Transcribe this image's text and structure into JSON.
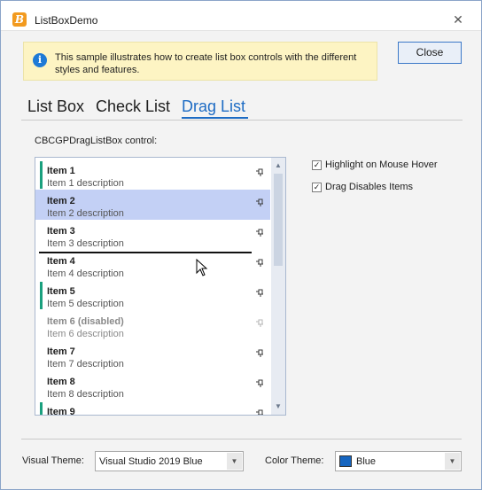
{
  "window": {
    "title": "ListBoxDemo",
    "app_icon_letter": "B"
  },
  "info": {
    "text": "This sample illustrates how to create list box controls with the different styles and features."
  },
  "buttons": {
    "close_label": "Close"
  },
  "tabs": [
    {
      "label": "List Box",
      "active": false
    },
    {
      "label": "Check List",
      "active": false
    },
    {
      "label": "Drag List",
      "active": true
    }
  ],
  "control_label": "CBCGPDragListBox control:",
  "list_items": [
    {
      "title": "Item 1",
      "desc": "Item 1 description",
      "accent": true,
      "selected": false,
      "disabled": false
    },
    {
      "title": "Item 2",
      "desc": "Item 2 description",
      "accent": false,
      "selected": true,
      "disabled": false
    },
    {
      "title": "Item 3",
      "desc": "Item 3 description",
      "accent": false,
      "selected": false,
      "disabled": false
    },
    {
      "title": "Item 4",
      "desc": "Item 4 description",
      "accent": false,
      "selected": false,
      "disabled": false
    },
    {
      "title": "Item 5",
      "desc": "Item 5 description",
      "accent": true,
      "selected": false,
      "disabled": false
    },
    {
      "title": "Item 6 (disabled)",
      "desc": "Item 6 description",
      "accent": false,
      "selected": false,
      "disabled": true
    },
    {
      "title": "Item 7",
      "desc": "Item 7 description",
      "accent": false,
      "selected": false,
      "disabled": false
    },
    {
      "title": "Item 8",
      "desc": "Item 8 description",
      "accent": false,
      "selected": false,
      "disabled": false
    },
    {
      "title": "Item 9",
      "desc": "",
      "accent": true,
      "selected": false,
      "disabled": false
    }
  ],
  "options": {
    "highlight_hover": {
      "label": "Highlight on Mouse Hover",
      "checked": true
    },
    "drag_disables": {
      "label": "Drag Disables Items",
      "checked": true
    }
  },
  "footer": {
    "visual_theme_label": "Visual Theme:",
    "visual_theme_value": "Visual Studio 2019 Blue",
    "color_theme_label": "Color Theme:",
    "color_theme_value": "Blue",
    "color_theme_swatch": "#1565c0"
  },
  "colors": {
    "accent": "#1e6cc4",
    "item_accent": "#1aa07e",
    "selection": "#c3d0f5"
  }
}
